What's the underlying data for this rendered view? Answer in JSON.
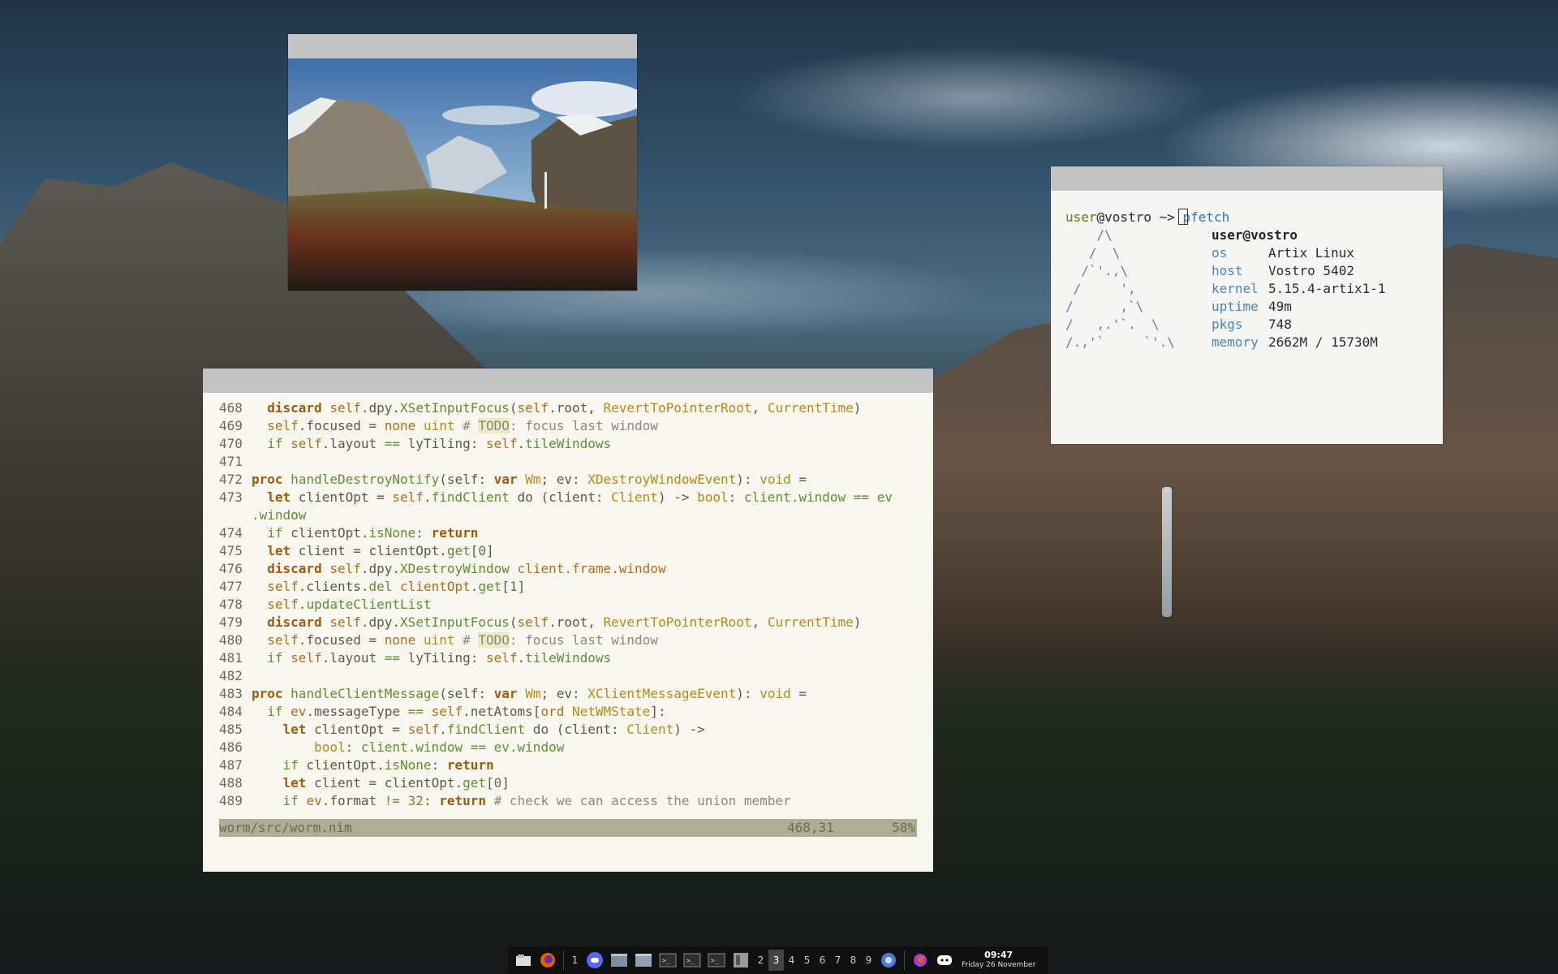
{
  "colors": {
    "titlebar": "#c3c3c3",
    "editor_bg": "#f7f6ef",
    "status_bg": "#aeae94",
    "terminal_bg": "#f5f5f3",
    "taskbar_bg": "#111111",
    "keyword": "#a05a0b",
    "function": "#5f8f2e",
    "type": "#b58a14"
  },
  "editor": {
    "lines": [
      {
        "n": "468",
        "html": "  <span class='kw'>discard</span> <span class='self'>self</span>.dpy.<span class='fn'>XSetInputFocus</span>(<span class='self'>self</span>.root, <span class='ty'>RevertToPointerRoot</span>, <span class='ty'>CurrentTime</span>)"
      },
      {
        "n": "469",
        "html": "  <span class='self'>self</span>.focused = <span class='self'>none</span> <span class='ty'>uint</span> <span class='cm'># <span class='todo'>TODO</span>: focus last window</span>"
      },
      {
        "n": "470",
        "html": "  <span class='fn'>if</span> <span class='self'>self</span>.layout <span class='fn'>==</span> lyTiling: <span class='self'>self</span>.<span class='fn'>tileWindows</span>"
      },
      {
        "n": "471",
        "html": ""
      },
      {
        "n": "472",
        "html": "<span class='kw'>proc</span> <span class='fn'>handleDestroyNotify</span>(self: <span class='kw'>var</span> <span class='ty'>Wm</span>; ev: <span class='ty'>XDestroyWindowEvent</span>): <span class='ty'>void</span> ="
      },
      {
        "n": "473",
        "html": "  <span class='kw'>let</span> clientOpt = <span class='self'>self</span>.<span class='fn'>findClient</span> do (client: <span class='ty'>Client</span>) -> <span class='ty'>bool</span>: <span class='fn'>client.window</span> <span class='fn'>==</span> <span class='fn'>ev</span>"
      },
      {
        "n": "",
        "html": "<span class='fn'>.window</span>"
      },
      {
        "n": "474",
        "html": "  <span class='fn'>if</span> clientOpt.<span class='fn'>isNone</span>: <span class='kw'>return</span>"
      },
      {
        "n": "475",
        "html": "  <span class='kw'>let</span> client = clientOpt.<span class='fn'>get</span>[<span class='num'>0</span>]"
      },
      {
        "n": "476",
        "html": "  <span class='kw'>discard</span> <span class='self'>self</span>.dpy.<span class='fn'>XDestroyWindow</span> <span class='self'>client.frame.window</span>"
      },
      {
        "n": "477",
        "html": "  <span class='self'>self</span>.clients.<span class='fn'>del</span> <span class='self'>clientOpt</span>.<span class='fn'>get</span>[<span class='num'>1</span>]"
      },
      {
        "n": "478",
        "html": "  <span class='self'>self</span>.<span class='fn'>updateClientList</span>"
      },
      {
        "n": "479",
        "html": "  <span class='kw'>discard</span> <span class='self'>self</span>.dpy.<span class='fn'>XSetInputFocus</span>(<span class='self'>self</span>.root, <span class='ty'>RevertToPointerRoot</span>, <span class='ty'>CurrentTime</span>)"
      },
      {
        "n": "480",
        "html": "  <span class='self'>self</span>.focused = <span class='self'>none</span> <span class='ty'>uint</span> <span class='cm'># <span class='todo'>TODO</span>: focus last window</span>"
      },
      {
        "n": "481",
        "html": "  <span class='fn'>if</span> <span class='self'>self</span>.layout <span class='fn'>==</span> lyTiling: <span class='self'>self</span>.<span class='fn'>tileWindows</span>"
      },
      {
        "n": "482",
        "html": ""
      },
      {
        "n": "483",
        "html": "<span class='kw'>proc</span> <span class='fn'>handleClientMessage</span>(self: <span class='kw'>var</span> <span class='ty'>Wm</span>; ev: <span class='ty'>XClientMessageEvent</span>): <span class='ty'>void</span> ="
      },
      {
        "n": "484",
        "html": "  <span class='fn'>if</span> <span class='self'>ev</span>.messageType <span class='fn'>==</span> <span class='self'>self</span>.netAtoms[<span class='self'>ord</span> <span class='ty'>NetWMState</span>]:"
      },
      {
        "n": "485",
        "html": "    <span class='kw'>let</span> clientOpt = <span class='self'>self</span>.<span class='fn'>findClient</span> do (client: <span class='ty'>Client</span>) ->"
      },
      {
        "n": "486",
        "html": "        <span class='ty'>bool</span>: <span class='fn'>client.window</span> <span class='fn'>==</span> <span class='fn'>ev.window</span>"
      },
      {
        "n": "487",
        "html": "    <span class='fn'>if</span> clientOpt.<span class='fn'>isNone</span>: <span class='kw'>return</span>"
      },
      {
        "n": "488",
        "html": "    <span class='kw'>let</span> client = clientOpt.<span class='fn'>get</span>[<span class='num'>0</span>]"
      },
      {
        "n": "489",
        "html": "    <span class='fn'>if</span> <span class='self'>ev</span>.format <span class='fn'>!=</span> <span class='self'>32</span>: <span class='kw'>return</span> <span class='cm'># check we can access the union member</span>"
      }
    ],
    "status_file": "worm/src/worm.nim",
    "status_pos": "468,31",
    "status_pct": "58%"
  },
  "terminal": {
    "prompt_user": "user",
    "prompt_host": "@vostro ~>",
    "command": "pfetch",
    "logo": "    /\\\n   /  \\\n  /`'.,\\\n /     ',\n/      ,`\\\n/   ,.'`.  \\\n/.,'`     `'.\\",
    "userhost": "user@vostro",
    "info": [
      {
        "key": "os",
        "value": "Artix Linux"
      },
      {
        "key": "host",
        "value": "Vostro 5402"
      },
      {
        "key": "kernel",
        "value": "5.15.4-artix1-1"
      },
      {
        "key": "uptime",
        "value": "49m"
      },
      {
        "key": "pkgs",
        "value": "748"
      },
      {
        "key": "memory",
        "value": "2662M / 15730M"
      }
    ]
  },
  "taskbar": {
    "workspace_current": "1",
    "workspaces": [
      "2",
      "3",
      "4",
      "5",
      "6",
      "7",
      "8",
      "9"
    ],
    "active_workspace": "3",
    "time": "09:47",
    "date": "Friday 26 November"
  }
}
